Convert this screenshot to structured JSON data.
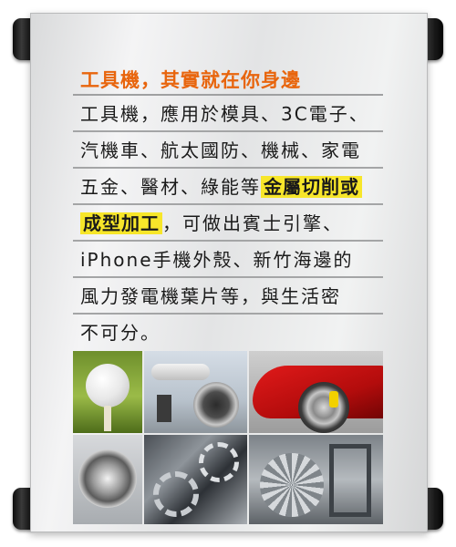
{
  "banner": {
    "heading": "工具機，其實就在你身邊",
    "lines": [
      {
        "text": "工具機，應用於模具、3C電子、"
      },
      {
        "text": "汽機車、航太國防、機械、家電"
      },
      {
        "text": "五金、醫材、綠能等",
        "highlight": "金屬切削或"
      },
      {
        "highlight": "成型加工",
        "text": "，可做出賓士引擎、"
      },
      {
        "text": "iPhone手機外殼、新竹海邊的"
      },
      {
        "text": "風力發電機葉片等，與生活密"
      },
      {
        "text": "不可分。"
      }
    ],
    "highlight_color": "#f7e62a",
    "heading_color": "#e8650d"
  },
  "photos": [
    {
      "subject": "golf-ball-icon"
    },
    {
      "subject": "airplane-engine-icon"
    },
    {
      "subject": "sports-car-wheel-icon"
    },
    {
      "subject": "metal-drill-part-icon"
    },
    {
      "subject": "machine-gears-icon"
    },
    {
      "subject": "turbine-part-icon"
    }
  ]
}
